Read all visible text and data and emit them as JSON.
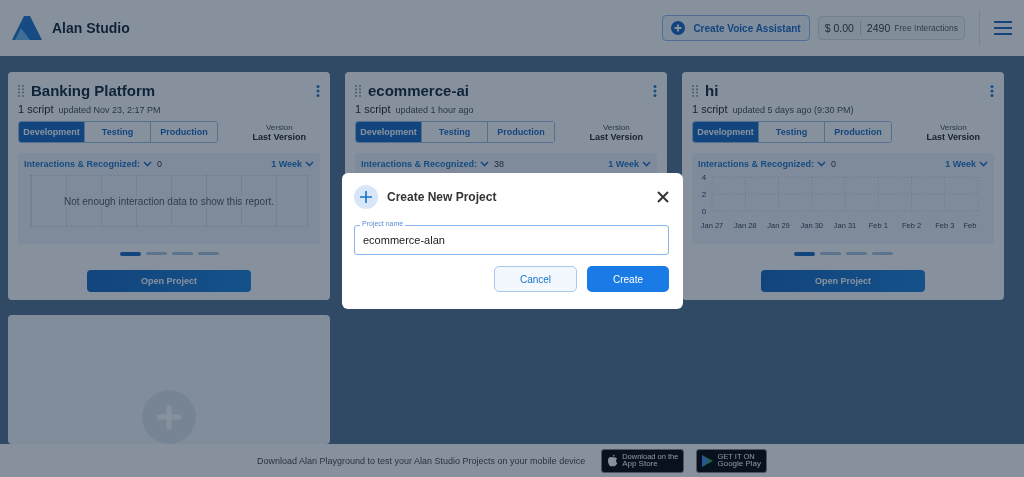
{
  "header": {
    "title": "Alan Studio",
    "create_button": "Create Voice Assistant",
    "balance": "$ 0.00",
    "interactions_count": "2490",
    "interactions_label": "Free Interactions"
  },
  "projects": [
    {
      "name": "Banking Platform",
      "scripts": "1 script",
      "updated": "updated Nov 23, 2:17 PM",
      "tabs": [
        {
          "label": "Development",
          "selected": true
        },
        {
          "label": "Testing",
          "selected": false
        },
        {
          "label": "Production",
          "selected": false
        }
      ],
      "version_label": "Version",
      "version": "Last Version",
      "metric": "Interactions & Recognized:",
      "metric_value": "0",
      "period": "1 Week",
      "kind": "empty",
      "message": "Not enough interaction data to show this report.",
      "pages": [
        {
          "selected": true
        },
        {
          "selected": false
        },
        {
          "selected": false
        },
        {
          "selected": false
        }
      ],
      "open_button": "Open Project"
    },
    {
      "name": "ecommerce-ai",
      "scripts": "1 script",
      "updated": "updated 1 hour ago",
      "tabs": [
        {
          "label": "Development",
          "selected": true
        },
        {
          "label": "Testing",
          "selected": false
        },
        {
          "label": "Production",
          "selected": false
        }
      ],
      "version_label": "Version",
      "version": "Last Version",
      "metric": "Interactions & Recognized:",
      "metric_value": "38",
      "period": "1 Week",
      "kind": "covered"
    },
    {
      "name": "hi",
      "scripts": "1 script",
      "updated": "updated 5 days ago (9:30 PM)",
      "tabs": [
        {
          "label": "Development",
          "selected": true
        },
        {
          "label": "Testing",
          "selected": false
        },
        {
          "label": "Production",
          "selected": false
        }
      ],
      "version_label": "Version",
      "version": "Last Version",
      "metric": "Interactions & Recognized:",
      "metric_value": "0",
      "period": "1 Week",
      "kind": "chart",
      "chart_data": {
        "type": "line",
        "categories": [
          "Jan 27",
          "Jan 28",
          "Jan 29",
          "Jan 30",
          "Jan 31",
          "Feb 1",
          "Feb 2",
          "Feb 3",
          "Feb"
        ],
        "ylim": [
          0,
          4
        ],
        "yticks": [
          0,
          2,
          4
        ],
        "grid": true
      },
      "pages": [
        {
          "selected": true
        },
        {
          "selected": false
        },
        {
          "selected": false
        },
        {
          "selected": false
        }
      ],
      "open_button": "Open Project"
    }
  ],
  "dialog": {
    "title": "Create New Project",
    "field_label": "Project name",
    "field_value": "ecommerce-alan",
    "cancel": "Cancel",
    "create": "Create"
  },
  "footer": {
    "text": "Download Alan Playground to test your Alan Studio Projects on your mobile device",
    "app_store_small": "Download on the",
    "app_store": "App Store",
    "google_small": "GET IT ON",
    "google": "Google Play"
  }
}
